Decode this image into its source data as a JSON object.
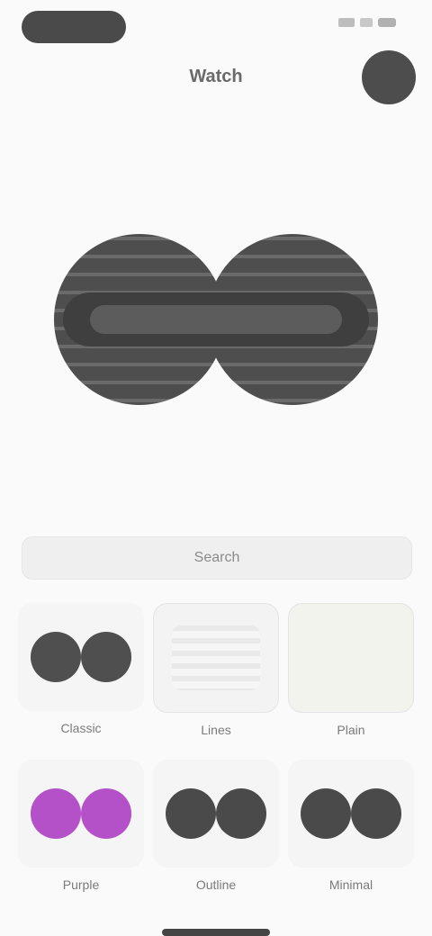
{
  "app": {
    "title": "Watch"
  },
  "search": {
    "placeholder": "Search"
  },
  "grid": {
    "items": [
      {
        "label": "Classic",
        "color": "#5a5a5a"
      },
      {
        "label": "Lines",
        "color": "#eaeaea"
      },
      {
        "label": "Plain",
        "color": "#f0f0ea"
      },
      {
        "label": "Purple",
        "color": "#b451c8"
      },
      {
        "label": "Outline",
        "color": "#4a4a4a"
      },
      {
        "label": "Minimal",
        "color": "#4a4a4a"
      }
    ]
  },
  "icons": {
    "avatar": "avatar",
    "hero": "dumbbell-watchface"
  },
  "colors": {
    "pill": "#4a4a4a",
    "accent_purple": "#b451c8"
  }
}
